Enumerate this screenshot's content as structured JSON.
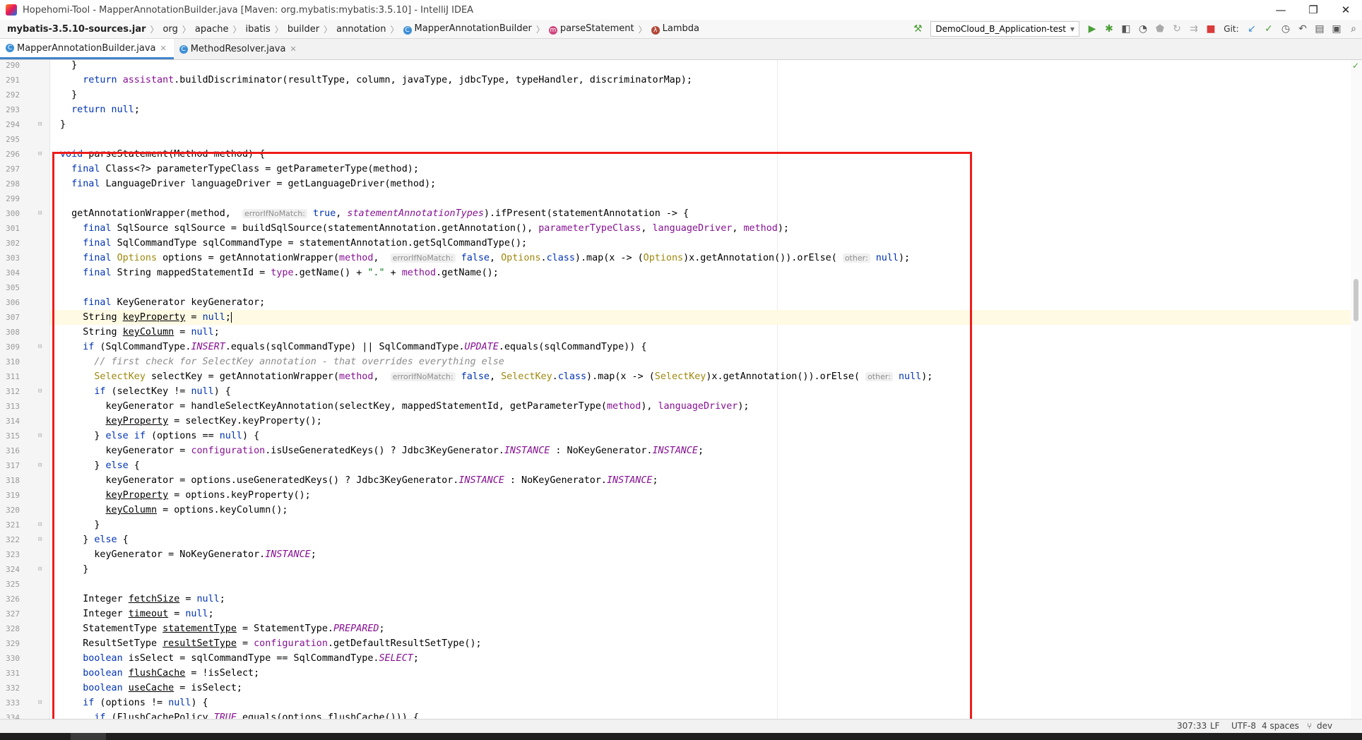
{
  "window": {
    "title": "Hopehomi-Tool - MapperAnnotationBuilder.java [Maven: org.mybatis:mybatis:3.5.10] - IntelliJ IDEA",
    "controls": {
      "minimize": "—",
      "restore": "❐",
      "close": "✕"
    }
  },
  "breadcrumb": [
    "mybatis-3.5.10-sources.jar",
    "org",
    "apache",
    "ibatis",
    "builder",
    "annotation",
    "MapperAnnotationBuilder",
    "parseStatement",
    "Lambda"
  ],
  "toolbar": {
    "run_config": "DemoCloud_B_Application-test",
    "git_label": "Git:"
  },
  "tabs": [
    {
      "label": "MapperAnnotationBuilder.java",
      "active": true
    },
    {
      "label": "MethodResolver.java",
      "active": false
    }
  ],
  "editor": {
    "current_line": 307,
    "lines": [
      {
        "n": "290",
        "html": "  }"
      },
      {
        "n": "291",
        "html": "    <span class=\"kw\">return</span> <span class=\"fld\">assistant</span>.buildDiscriminator(resultType, column, javaType, jdbcType, typeHandler, discriminatorMap);"
      },
      {
        "n": "292",
        "html": "  }"
      },
      {
        "n": "293",
        "html": "  <span class=\"kw\">return null</span>;"
      },
      {
        "n": "294",
        "html": "}"
      },
      {
        "n": "295",
        "html": ""
      },
      {
        "n": "296",
        "html": "<span class=\"kw\">void</span> parseStatement(Method method) {"
      },
      {
        "n": "297",
        "html": "  <span class=\"kw\">final</span> Class&lt;?&gt; parameterTypeClass = getParameterType(method);"
      },
      {
        "n": "298",
        "html": "  <span class=\"kw\">final</span> LanguageDriver languageDriver = getLanguageDriver(method);"
      },
      {
        "n": "299",
        "html": ""
      },
      {
        "n": "300",
        "html": "  getAnnotationWrapper(method,  <span class=\"hint\">errorIfNoMatch:</span> <span class=\"kw\">true</span>, <span class=\"sfld\">statementAnnotationTypes</span>).ifPresent(statementAnnotation -&gt; {"
      },
      {
        "n": "301",
        "html": "    <span class=\"kw\">final</span> SqlSource sqlSource = buildSqlSource(statementAnnotation.getAnnotation(), <span class=\"fld\">parameterTypeClass</span>, <span class=\"fld\">languageDriver</span>, <span class=\"fld\">method</span>);"
      },
      {
        "n": "302",
        "html": "    <span class=\"kw\">final</span> SqlCommandType sqlCommandType = statementAnnotation.getSqlCommandType();"
      },
      {
        "n": "303",
        "html": "    <span class=\"kw\">final</span> <span class=\"ann\">Options</span> options = getAnnotationWrapper(<span class=\"fld\">method</span>,  <span class=\"hint\">errorIfNoMatch:</span> <span class=\"kw\">false</span>, <span class=\"ann\">Options</span>.<span class=\"kw\">class</span>).map(x -&gt; (<span class=\"ann\">Options</span>)x.getAnnotation()).orElse( <span class=\"hint\">other:</span> <span class=\"kw\">null</span>);"
      },
      {
        "n": "304",
        "html": "    <span class=\"kw\">final</span> String mappedStatementId = <span class=\"fld\">type</span>.getName() + <span class=\"str\">\".\"</span> + <span class=\"fld\">method</span>.getName();"
      },
      {
        "n": "305",
        "html": ""
      },
      {
        "n": "306",
        "html": "    <span class=\"kw\">final</span> KeyGenerator keyGenerator;"
      },
      {
        "n": "307",
        "html": "    String <span class=\"uline\">keyProperty</span> = <span class=\"kw\">null</span>;<span class=\"caret\"></span>"
      },
      {
        "n": "308",
        "html": "    String <span class=\"uline\">keyColumn</span> = <span class=\"kw\">null</span>;"
      },
      {
        "n": "309",
        "html": "    <span class=\"kw\">if</span> (SqlCommandType.<span class=\"sfld\">INSERT</span>.equals(sqlCommandType) || SqlCommandType.<span class=\"sfld\">UPDATE</span>.equals(sqlCommandType)) {"
      },
      {
        "n": "310",
        "html": "      <span class=\"cmt\">// first check for SelectKey annotation - that overrides everything else</span>"
      },
      {
        "n": "311",
        "html": "      <span class=\"ann\">SelectKey</span> selectKey = getAnnotationWrapper(<span class=\"fld\">method</span>,  <span class=\"hint\">errorIfNoMatch:</span> <span class=\"kw\">false</span>, <span class=\"ann\">SelectKey</span>.<span class=\"kw\">class</span>).map(x -&gt; (<span class=\"ann\">SelectKey</span>)x.getAnnotation()).orElse( <span class=\"hint\">other:</span> <span class=\"kw\">null</span>);"
      },
      {
        "n": "312",
        "html": "      <span class=\"kw\">if</span> (selectKey != <span class=\"kw\">null</span>) {"
      },
      {
        "n": "313",
        "html": "        keyGenerator = handleSelectKeyAnnotation(selectKey, mappedStatementId, getParameterType(<span class=\"fld\">method</span>), <span class=\"fld\">languageDriver</span>);"
      },
      {
        "n": "314",
        "html": "        <span class=\"uline\">keyProperty</span> = selectKey.keyProperty();"
      },
      {
        "n": "315",
        "html": "      } <span class=\"kw\">else if</span> (options == <span class=\"kw\">null</span>) {"
      },
      {
        "n": "316",
        "html": "        keyGenerator = <span class=\"fld\">configuration</span>.isUseGeneratedKeys() ? Jdbc3KeyGenerator.<span class=\"sfld\">INSTANCE</span> : NoKeyGenerator.<span class=\"sfld\">INSTANCE</span>;"
      },
      {
        "n": "317",
        "html": "      } <span class=\"kw\">else</span> {"
      },
      {
        "n": "318",
        "html": "        keyGenerator = options.useGeneratedKeys() ? Jdbc3KeyGenerator.<span class=\"sfld\">INSTANCE</span> : NoKeyGenerator.<span class=\"sfld\">INSTANCE</span>;"
      },
      {
        "n": "319",
        "html": "        <span class=\"uline\">keyProperty</span> = options.keyProperty();"
      },
      {
        "n": "320",
        "html": "        <span class=\"uline\">keyColumn</span> = options.keyColumn();"
      },
      {
        "n": "321",
        "html": "      }"
      },
      {
        "n": "322",
        "html": "    } <span class=\"kw\">else</span> {"
      },
      {
        "n": "323",
        "html": "      keyGenerator = NoKeyGenerator.<span class=\"sfld\">INSTANCE</span>;"
      },
      {
        "n": "324",
        "html": "    }"
      },
      {
        "n": "325",
        "html": ""
      },
      {
        "n": "326",
        "html": "    Integer <span class=\"uline\">fetchSize</span> = <span class=\"kw\">null</span>;"
      },
      {
        "n": "327",
        "html": "    Integer <span class=\"uline\">timeout</span> = <span class=\"kw\">null</span>;"
      },
      {
        "n": "328",
        "html": "    StatementType <span class=\"uline\">statementType</span> = StatementType.<span class=\"sfld\">PREPARED</span>;"
      },
      {
        "n": "329",
        "html": "    ResultSetType <span class=\"uline\">resultSetType</span> = <span class=\"fld\">configuration</span>.getDefaultResultSetType();"
      },
      {
        "n": "330",
        "html": "    <span class=\"kw\">boolean</span> isSelect = sqlCommandType == SqlCommandType.<span class=\"sfld\">SELECT</span>;"
      },
      {
        "n": "331",
        "html": "    <span class=\"kw\">boolean</span> <span class=\"uline\">flushCache</span> = !isSelect;"
      },
      {
        "n": "332",
        "html": "    <span class=\"kw\">boolean</span> <span class=\"uline\">useCache</span> = isSelect;"
      },
      {
        "n": "333",
        "html": "    <span class=\"kw\">if</span> (options != <span class=\"kw\">null</span>) {"
      },
      {
        "n": "334",
        "html": "      <span class=\"kw\">if</span> (FlushCachePolicy.<span class=\"sfld\">TRUE</span>.equals(options.flushCache())) {"
      }
    ]
  },
  "statusbar": {
    "position": "307:33",
    "line_sep": "LF",
    "encoding": "UTF-8",
    "indent": "4 spaces",
    "branch": "dev"
  }
}
